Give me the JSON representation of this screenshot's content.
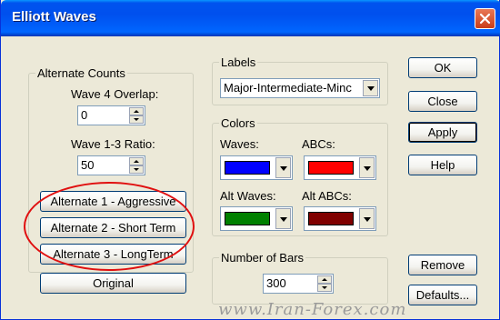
{
  "window": {
    "title": "Elliott Waves"
  },
  "alternate_counts": {
    "legend": "Alternate Counts",
    "wave4_overlap_label": "Wave 4 Overlap:",
    "wave4_overlap_value": "0",
    "wave13_ratio_label": "Wave 1-3 Ratio:",
    "wave13_ratio_value": "50",
    "buttons": {
      "alt1": "Alternate 1 - Aggressive",
      "alt2": "Alternate 2 - Short Term",
      "alt3": "Alternate 3 - LongTerm",
      "original": "Original"
    }
  },
  "labels_group": {
    "legend": "Labels",
    "selected": "Major-Intermediate-Minc"
  },
  "colors_group": {
    "legend": "Colors",
    "waves_label": "Waves:",
    "abcs_label": "ABCs:",
    "alt_waves_label": "Alt Waves:",
    "alt_abcs_label": "Alt ABCs:",
    "waves_color": "#0000ff",
    "abcs_color": "#ff0000",
    "alt_waves_color": "#008000",
    "alt_abcs_color": "#800000"
  },
  "bars_group": {
    "legend": "Number of Bars",
    "value": "300"
  },
  "side_buttons": {
    "ok": "OK",
    "close": "Close",
    "apply": "Apply",
    "help": "Help",
    "remove": "Remove",
    "defaults": "Defaults..."
  },
  "annotation": {
    "color": "#e01010"
  },
  "watermark": "www.Iran-Forex.com"
}
